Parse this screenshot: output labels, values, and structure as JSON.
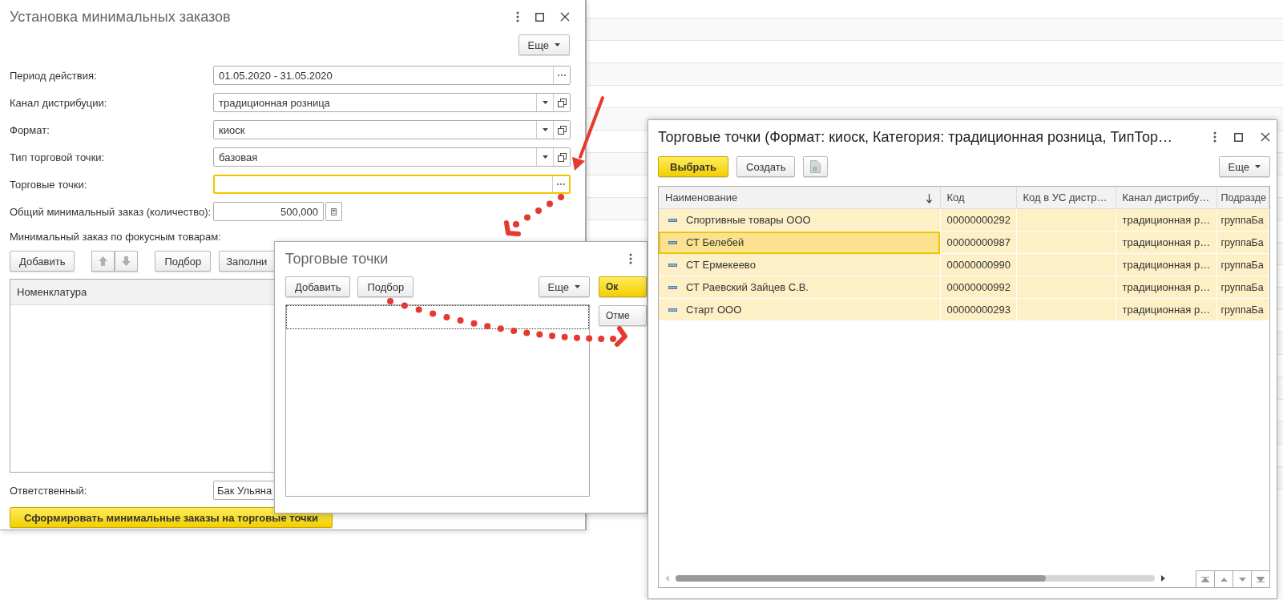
{
  "main_window": {
    "title": "Установка минимальных заказов",
    "more_button": "Еще",
    "fields": [
      {
        "kind": "period",
        "label": "Период действия:",
        "value": "01.05.2020 - 31.05.2020",
        "focused": false
      },
      {
        "kind": "dropdown",
        "label": "Канал дистрибуции:",
        "value": "традиционная розница",
        "focused": false
      },
      {
        "kind": "dropdown",
        "label": "Формат:",
        "value": "киоск",
        "focused": false
      },
      {
        "kind": "dropdown",
        "label": "Тип торговой точки:",
        "value": "базовая",
        "focused": false
      },
      {
        "kind": "select",
        "label": "Торговые точки:",
        "focused": true
      },
      {
        "kind": "number",
        "label": "Общий минимальный заказ (количество):",
        "value": "500,000",
        "focused": false
      }
    ],
    "section_label": "Минимальный заказ по фокусным товарам:",
    "toolbar": {
      "add_button": "Добавить",
      "pick_button": "Подбор",
      "fill_button": "Заполни"
    },
    "table": {
      "columns": [
        "Номенклатура"
      ]
    },
    "responsible": {
      "label": "Ответственный:",
      "value": "Бак Ульяна"
    },
    "generate_button": "Сформировать минимальные заказы на торговые точки"
  },
  "picker_window": {
    "title": "Торговые точки",
    "add_button": "Добавить",
    "pick_button": "Подбор",
    "more_button": "Еще",
    "ok_button": "Ок",
    "cancel_button": "Отме"
  },
  "list_window": {
    "title": "Торговые точки (Формат: киоск, Категория: традиционная розница, ТипТор…",
    "select_button": "Выбрать",
    "create_button": "Создать",
    "more_button": "Еще",
    "columns": [
      {
        "label": "Наименование",
        "sorted": true
      },
      {
        "label": "Код",
        "sorted": false
      },
      {
        "label": "Код в УС дистр…",
        "sorted": false
      },
      {
        "label": "Канал дистрибу…",
        "sorted": false
      },
      {
        "label": "Подразде",
        "sorted": false
      }
    ],
    "rows": [
      {
        "name": "Спортивные товары ООО",
        "code": "00000000292",
        "channel": "традиционная р…",
        "division": "группаБа",
        "selected": false
      },
      {
        "name": "СТ Белебей",
        "code": "00000000987",
        "channel": "традиционная р…",
        "division": "группаБа",
        "selected": true
      },
      {
        "name": "СТ Ермекеево",
        "code": "00000000990",
        "channel": "традиционная р…",
        "division": "группаБа",
        "selected": false
      },
      {
        "name": "СТ Раевский Зайцев С.В.",
        "code": "00000000992",
        "channel": "традиционная р…",
        "division": "группаБа",
        "selected": false
      },
      {
        "name": "Старт ООО",
        "code": "00000000293",
        "channel": "традиционная р…",
        "division": "группаБа",
        "selected": false
      }
    ]
  }
}
